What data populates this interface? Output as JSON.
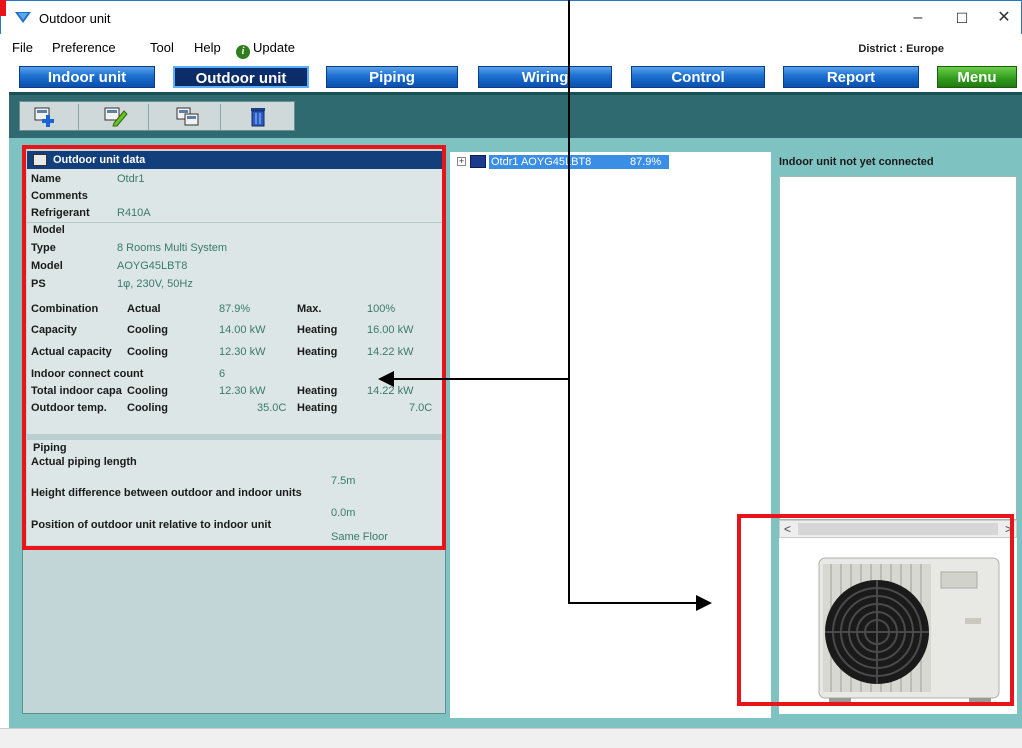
{
  "window": {
    "title": "Outdoor unit",
    "minimize_glyph": "–",
    "maximize_glyph": "☐",
    "close_glyph": "✕"
  },
  "menubar": {
    "items": [
      "File",
      "Preference",
      "Tool",
      "Help"
    ],
    "update_label": "Update",
    "update_icon_glyph": "i",
    "district": "District : Europe"
  },
  "tabs": {
    "indoor": "Indoor unit",
    "outdoor": "Outdoor unit",
    "piping": "Piping",
    "wiring": "Wiring",
    "control": "Control",
    "report": "Report",
    "menu": "Menu"
  },
  "toolbar": {
    "icons": [
      "add-unit-icon",
      "edit-unit-icon",
      "copy-unit-icon",
      "delete-unit-icon"
    ]
  },
  "outdoor_data": {
    "header": "Outdoor unit data",
    "name_label": "Name",
    "name_value": "Otdr1",
    "comments_label": "Comments",
    "refrigerant_label": "Refrigerant",
    "refrigerant_value": "R410A",
    "model_section": "Model",
    "type_label": "Type",
    "type_value": "8 Rooms Multi System",
    "model_label": "Model",
    "model_value": "AOYG45LBT8",
    "ps_label": "PS",
    "ps_value": "1φ, 230V, 50Hz",
    "combination_label": "Combination",
    "combination_actual_label": "Actual",
    "combination_actual_value": "87.9%",
    "combination_max_label": "Max.",
    "combination_max_value": "100%",
    "capacity_label": "Capacity",
    "cooling_label": "Cooling",
    "heating_label": "Heating",
    "capacity_cooling": "14.00 kW",
    "capacity_heating": "16.00 kW",
    "actual_capacity_label": "Actual capacity",
    "actual_capacity_cooling": "12.30 kW",
    "actual_capacity_heating": "14.22 kW",
    "indoor_connect_label": "Indoor connect count",
    "indoor_connect_value": "6",
    "total_indoor_label": "Total indoor capa",
    "total_indoor_cooling": "12.30 kW",
    "total_indoor_heating": "14.22 kW",
    "outdoor_temp_label": "Outdoor temp.",
    "outdoor_temp_cooling": "35.0C",
    "outdoor_temp_heating": "7.0C",
    "piping_section": "Piping",
    "piping_length_label": "Actual piping length",
    "piping_length_value": "7.5m",
    "height_diff_label": "Height difference between outdoor and indoor units",
    "height_diff_value": "0.0m",
    "position_label": "Position of outdoor unit relative to indoor unit",
    "position_value": "Same Floor"
  },
  "tree": {
    "expand_glyph": "+",
    "node_label": "Otdr1  AOYG45LBT8",
    "node_percent": "87.9%"
  },
  "right_panel": {
    "title": "Indoor unit not yet connected",
    "scroll_left": "<",
    "scroll_right": ">"
  },
  "colors": {
    "accent_blue": "#1b6fd0",
    "annotation_red": "#e8141a",
    "panel_teal": "#7fc2c2",
    "toolbar_teal": "#2e6a70",
    "value_green": "#3a7a6a"
  }
}
